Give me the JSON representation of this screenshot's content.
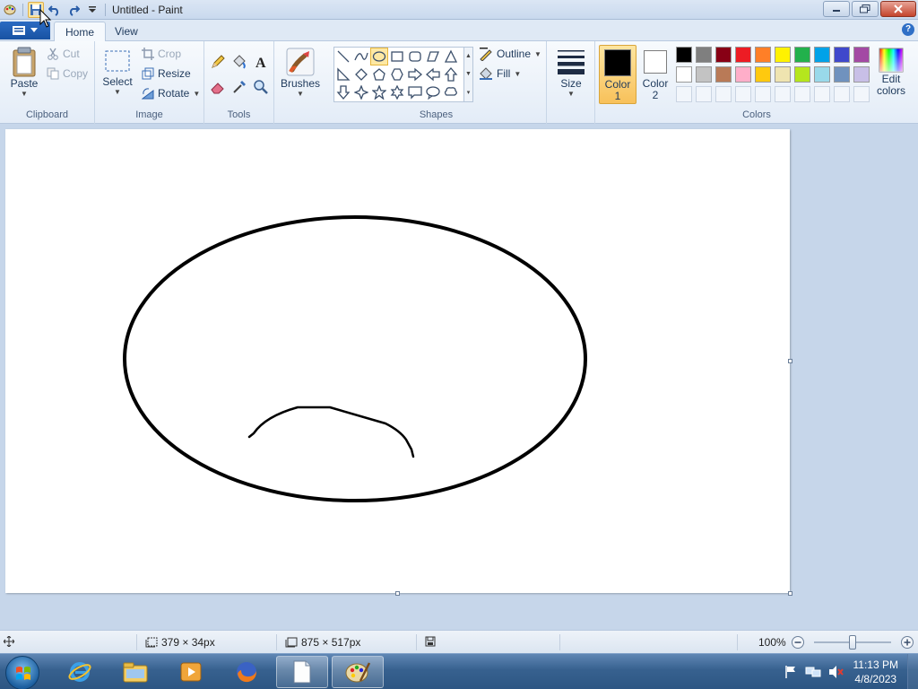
{
  "window": {
    "title": "Untitled - Paint",
    "quick_access": [
      "save-icon",
      "undo-icon",
      "redo-icon",
      "customize-qat-icon"
    ]
  },
  "tabs": {
    "file_menu": "paint-menu-icon",
    "home": "Home",
    "view": "View"
  },
  "clipboard": {
    "paste": "Paste",
    "cut": "Cut",
    "copy": "Copy",
    "label": "Clipboard"
  },
  "image": {
    "select": "Select",
    "crop": "Crop",
    "resize": "Resize",
    "rotate": "Rotate",
    "label": "Image"
  },
  "tools": {
    "label": "Tools",
    "items": [
      "pencil-icon",
      "fill-icon",
      "text-icon",
      "eraser-icon",
      "color-picker-icon",
      "magnifier-icon"
    ]
  },
  "brushes": {
    "label": "Brushes"
  },
  "shapes": {
    "label": "Shapes",
    "outline": "Outline",
    "fill": "Fill",
    "selected": "oval"
  },
  "size": {
    "label": "Size"
  },
  "colors": {
    "color1_label_line1": "Color",
    "color1_label_line2": "1",
    "color2_label_line1": "Color",
    "color2_label_line2": "2",
    "color1": "#000000",
    "color2": "#ffffff",
    "edit_label_line1": "Edit",
    "edit_label_line2": "colors",
    "label": "Colors",
    "palette_row1": [
      "#000000",
      "#7f7f7f",
      "#880015",
      "#ed1c24",
      "#ff7f27",
      "#fff200",
      "#22b14c",
      "#00a2e8",
      "#3f48cc",
      "#a349a4"
    ],
    "palette_row2": [
      "#ffffff",
      "#c3c3c3",
      "#b97a57",
      "#ffaec9",
      "#ffc90e",
      "#efe4b0",
      "#b5e61d",
      "#99d9ea",
      "#7092be",
      "#c8bfe7"
    ]
  },
  "status": {
    "selection_size": "379 × 34px",
    "canvas_size": "875 × 517px",
    "zoom": "100%",
    "zoom_fraction": 0.5
  },
  "taskbar": {
    "apps": [
      "ie-icon",
      "explorer-icon",
      "media-player-icon",
      "firefox-icon",
      "notepad-icon",
      "paint-icon"
    ],
    "time": "11:13 PM",
    "date": "4/8/2023"
  }
}
